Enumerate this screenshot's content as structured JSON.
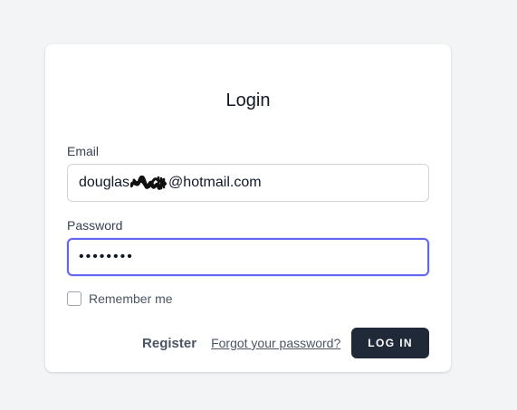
{
  "login": {
    "title": "Login",
    "email_label": "Email",
    "email_prefix": "douglas",
    "email_suffix": "@hotmail.com",
    "password_label": "Password",
    "password_masked": "••••••••",
    "remember_label": "Remember me",
    "register_label": "Register",
    "forgot_label": "Forgot your password?",
    "login_button_label": "LOG IN"
  },
  "colors": {
    "page_background": "#f3f4f6",
    "card_background": "#ffffff",
    "focus_border": "#6366f1",
    "button_background": "#1f2937",
    "button_text": "#ffffff",
    "muted_text": "#4b5563"
  },
  "icons": {
    "redaction": "scribble-redaction-icon"
  }
}
